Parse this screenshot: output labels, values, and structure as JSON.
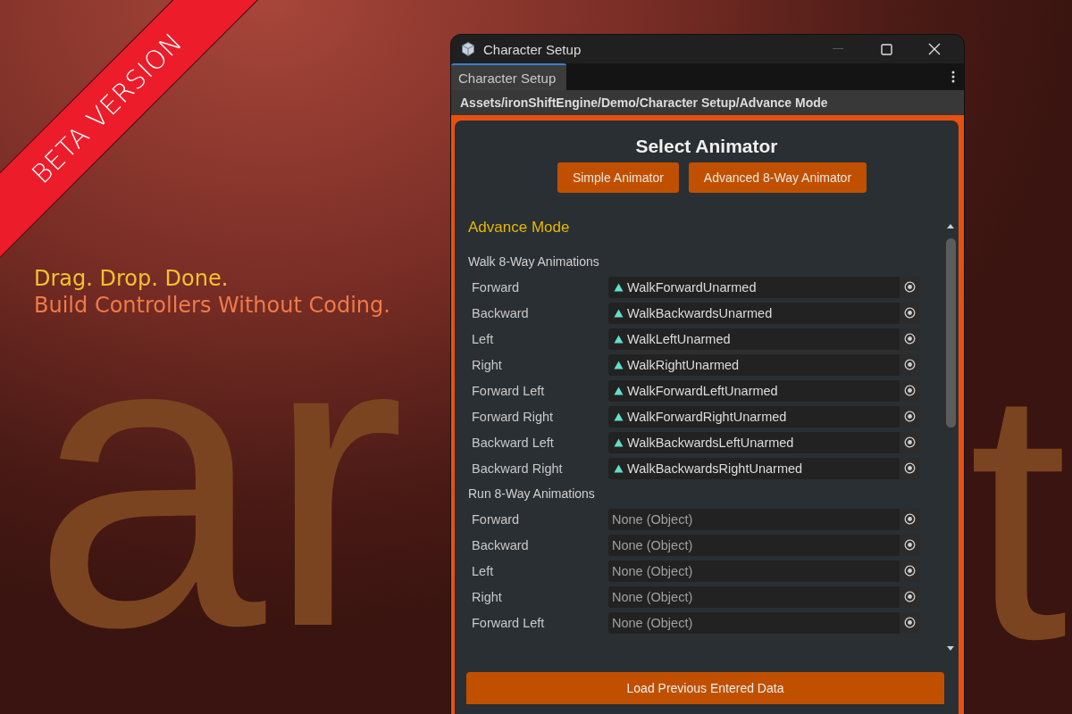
{
  "background": {
    "big_text": [
      {
        "text": "ar"
      },
      {
        "text": "t"
      }
    ],
    "ribbon": "BETA VERSION",
    "headline": "Drag. Drop. Done.",
    "subline": "Build Controllers Without Coding."
  },
  "window": {
    "title": "Character Setup",
    "tab": {
      "label": "Character Setup",
      "selected": true
    },
    "path": "Assets/ironShiftEngine/Demo/Character Setup/Advance Mode"
  },
  "panel": {
    "title": "Select Animator",
    "buttons": [
      "Simple Animator",
      "Advanced 8-Way Animator"
    ],
    "mode_title": "Advance Mode",
    "sections": [
      {
        "title": "Walk 8-Way Animations",
        "rows": [
          {
            "label": "Forward",
            "value": "WalkForwardUnarmed",
            "kind": "clip"
          },
          {
            "label": "Backward",
            "value": "WalkBackwardsUnarmed",
            "kind": "clip"
          },
          {
            "label": "Left",
            "value": "WalkLeftUnarmed",
            "kind": "clip"
          },
          {
            "label": "Right",
            "value": "WalkRightUnarmed",
            "kind": "clip"
          },
          {
            "label": "Forward Left",
            "value": "WalkForwardLeftUnarmed",
            "kind": "clip"
          },
          {
            "label": "Forward Right",
            "value": "WalkForwardRightUnarmed",
            "kind": "clip"
          },
          {
            "label": "Backward Left",
            "value": "WalkBackwardsLeftUnarmed",
            "kind": "clip"
          },
          {
            "label": "Backward Right",
            "value": "WalkBackwardsRightUnarmed",
            "kind": "clip"
          }
        ]
      },
      {
        "title": "Run 8-Way Animations",
        "rows": [
          {
            "label": "Forward",
            "value": "None (Object)",
            "kind": "empty"
          },
          {
            "label": "Backward",
            "value": "None (Object)",
            "kind": "empty"
          },
          {
            "label": "Left",
            "value": "None (Object)",
            "kind": "empty"
          },
          {
            "label": "Right",
            "value": "None (Object)",
            "kind": "empty"
          },
          {
            "label": "Forward Left",
            "value": "None (Object)",
            "kind": "empty"
          }
        ]
      }
    ],
    "load_button": "Load Previous Entered Data"
  }
}
